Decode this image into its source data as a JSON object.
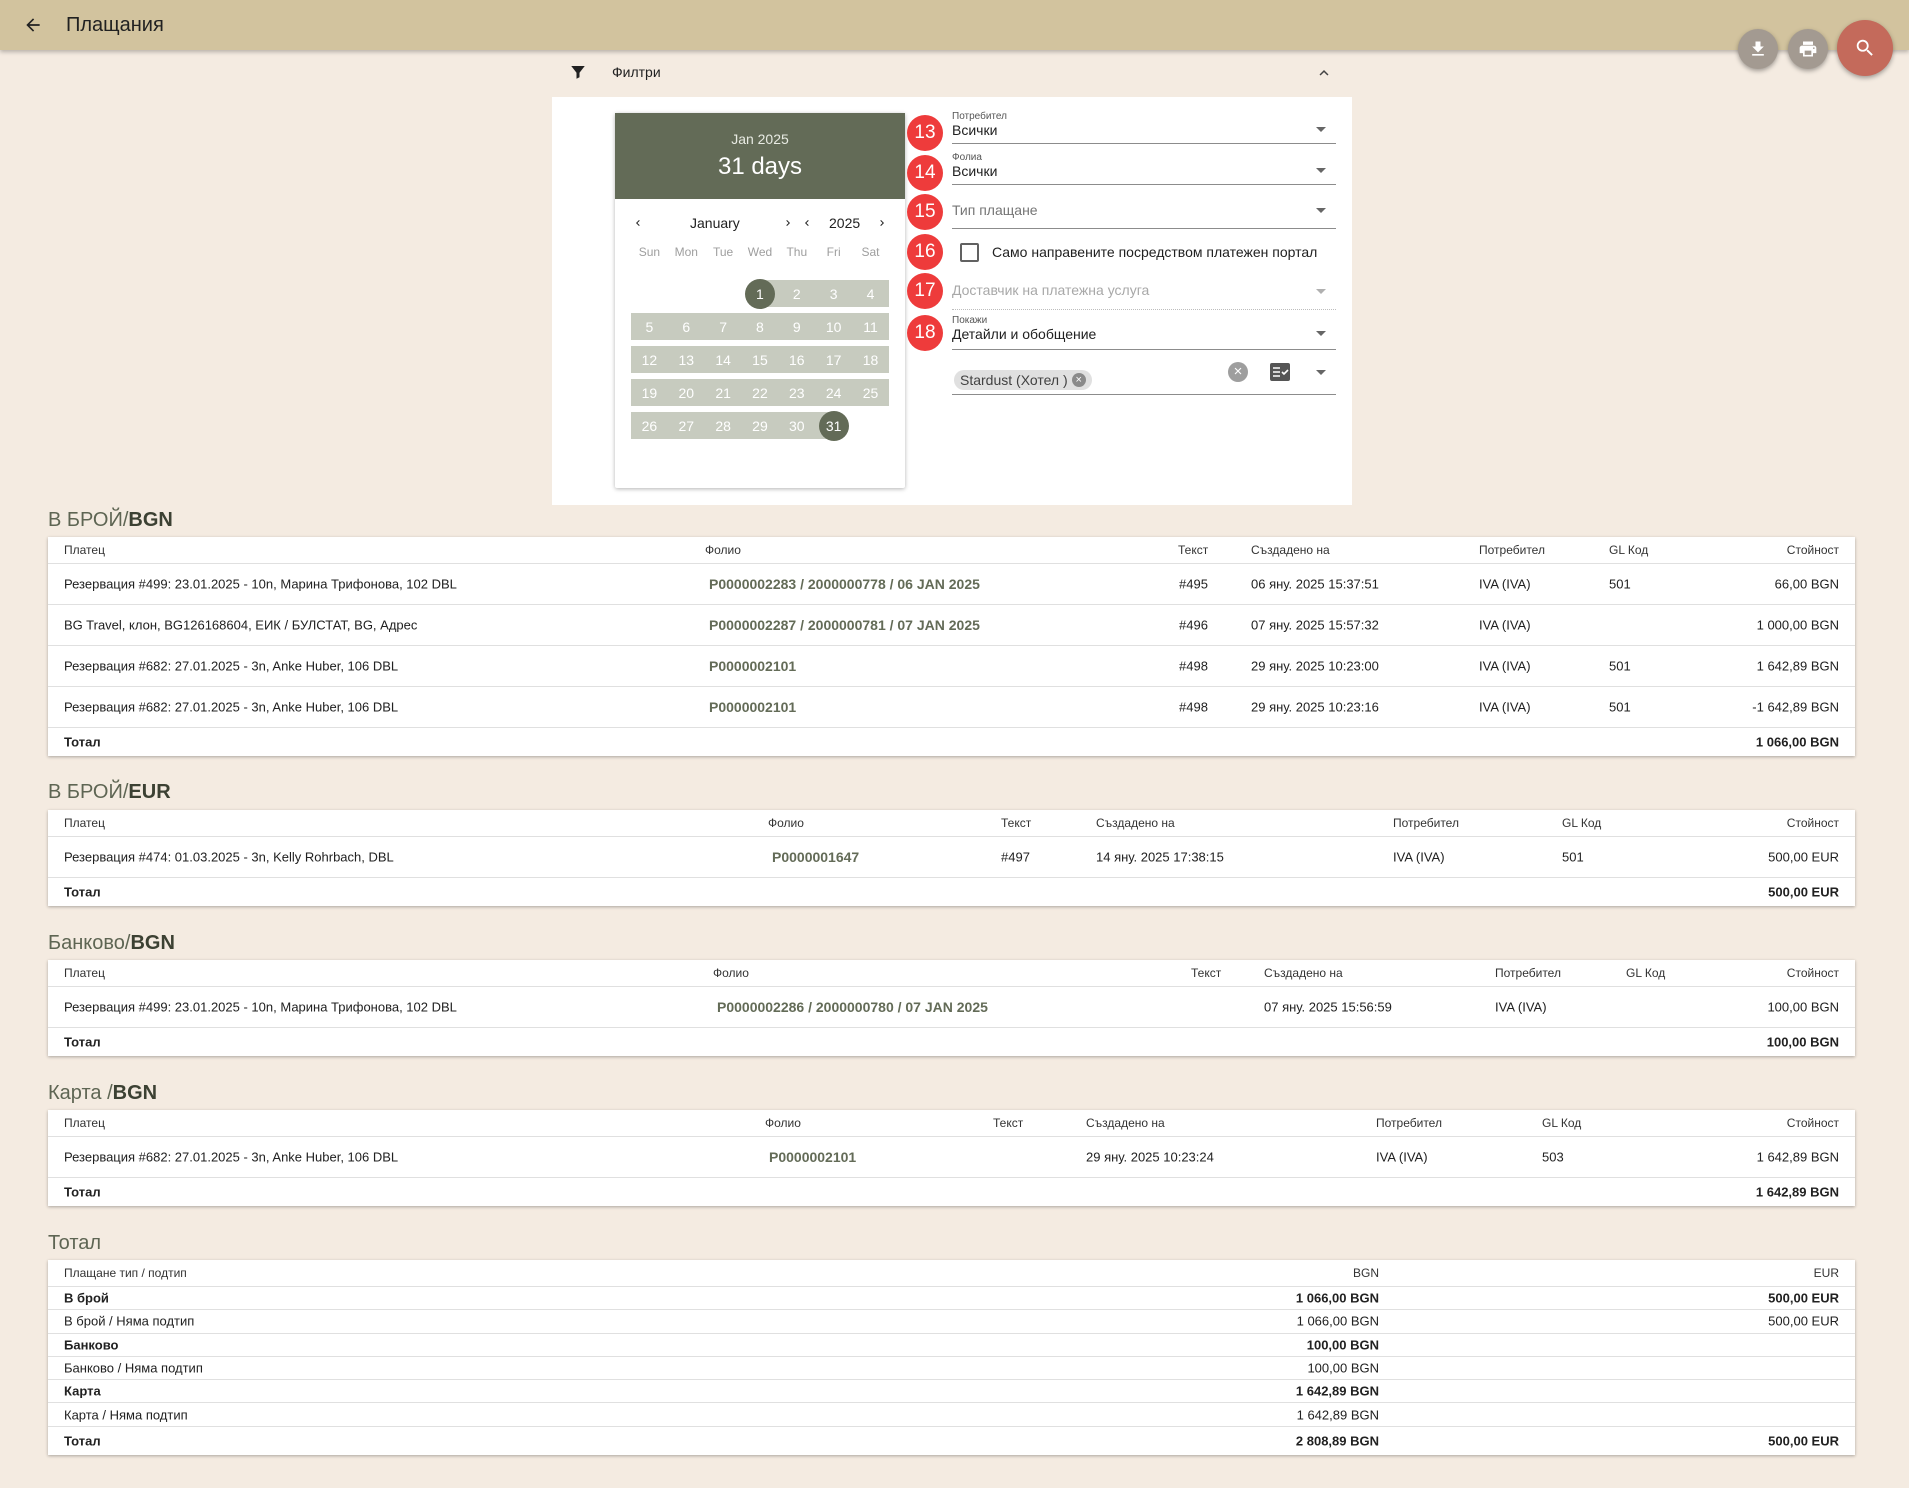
{
  "app": {
    "title": "Плащания"
  },
  "filters": {
    "label": "Филтри",
    "calendar": {
      "header_month": "Jan 2025",
      "header_days": "31 days",
      "month": "January",
      "year": "2025",
      "weekdays": [
        "Sun",
        "Mon",
        "Tue",
        "Wed",
        "Thu",
        "Fri",
        "Sat"
      ],
      "range_start": 1,
      "range_end": 31,
      "leading_blanks": 3,
      "days_in_month": 31
    },
    "fields": {
      "user": {
        "badge": "13",
        "label": "Потребител",
        "value": "Всички"
      },
      "folio": {
        "badge": "14",
        "label": "Фолиа",
        "value": "Всички"
      },
      "payment_type": {
        "badge": "15",
        "placeholder": "Тип плащане"
      },
      "portal_only": {
        "badge": "16",
        "label": "Само направените посредством платежен портал",
        "checked": false
      },
      "provider": {
        "badge": "17",
        "placeholder": "Доставчик на платежна услуга"
      },
      "show": {
        "badge": "18",
        "label": "Покажи",
        "value": "Детайли и обобщение"
      },
      "property_chip": "Stardust (Хотел )"
    }
  },
  "sections": [
    {
      "title_prefix": "В БРОЙ/",
      "title_currency": "BGN",
      "headers": {
        "payer": "Платец",
        "folio": "Фолио",
        "text": "Текст",
        "created": "Създадено на",
        "user": "Потребител",
        "gl": "GL Код",
        "amount": "Стойност"
      },
      "rows": [
        {
          "payer": "Резервация #499: 23.01.2025 - 10n, Марина Трифонова, 102 DBL",
          "folio": "P0000002283 / 2000000778 / 06 JAN 2025",
          "text": "#495",
          "created": "06 яну. 2025 15:37:51",
          "user": "IVA (IVA)",
          "gl": "501",
          "amount": "66,00 BGN"
        },
        {
          "payer": "BG Travel, клон, BG126168604, ЕИК / БУЛСТАТ, BG, Адрес",
          "folio": "P0000002287 / 2000000781 / 07 JAN 2025",
          "text": "#496",
          "created": "07 яну. 2025 15:57:32",
          "user": "IVA (IVA)",
          "gl": "",
          "amount": "1 000,00 BGN"
        },
        {
          "payer": "Резервация #682: 27.01.2025 - 3n, Anke Huber, 106 DBL",
          "folio": "P0000002101",
          "text": "#498",
          "created": "29 яну. 2025 10:23:00",
          "user": "IVA (IVA)",
          "gl": "501",
          "amount": "1 642,89 BGN"
        },
        {
          "payer": "Резервация #682: 27.01.2025 - 3n, Anke Huber, 106 DBL",
          "folio": "P0000002101",
          "text": "#498",
          "created": "29 яну. 2025 10:23:16",
          "user": "IVA (IVA)",
          "gl": "501",
          "amount": "-1 642,89 BGN"
        }
      ],
      "total_label": "Тотал",
      "total": "1 066,00 BGN"
    },
    {
      "title_prefix": "В БРОЙ/",
      "title_currency": "EUR",
      "headers": {
        "payer": "Платец",
        "folio": "Фолио",
        "text": "Текст",
        "created": "Създадено на",
        "user": "Потребител",
        "gl": "GL Код",
        "amount": "Стойност"
      },
      "rows": [
        {
          "payer": "Резервация #474: 01.03.2025 - 3n, Kelly Rohrbach, DBL",
          "folio": "P0000001647",
          "text": "#497",
          "created": "14 яну. 2025 17:38:15",
          "user": "IVA (IVA)",
          "gl": "501",
          "amount": "500,00 EUR"
        }
      ],
      "total_label": "Тотал",
      "total": "500,00 EUR"
    },
    {
      "title_prefix": "Банково/",
      "title_currency": "BGN",
      "headers": {
        "payer": "Платец",
        "folio": "Фолио",
        "text": "Текст",
        "created": "Създадено на",
        "user": "Потребител",
        "gl": "GL Код",
        "amount": "Стойност"
      },
      "rows": [
        {
          "payer": "Резервация #499: 23.01.2025 - 10n, Марина Трифонова, 102 DBL",
          "folio": "P0000002286 / 2000000780 / 07 JAN 2025",
          "text": "",
          "created": "07 яну. 2025 15:56:59",
          "user": "IVA (IVA)",
          "gl": "",
          "amount": "100,00 BGN"
        }
      ],
      "total_label": "Тотал",
      "total": "100,00 BGN"
    },
    {
      "title_prefix": "Карта /",
      "title_currency": "BGN",
      "headers": {
        "payer": "Платец",
        "folio": "Фолио",
        "text": "Текст",
        "created": "Създадено на",
        "user": "Потребител",
        "gl": "GL Код",
        "amount": "Стойност"
      },
      "rows": [
        {
          "payer": "Резервация #682: 27.01.2025 - 3n, Anke Huber, 106 DBL",
          "folio": "P0000002101",
          "text": "",
          "created": "29 яну. 2025 10:23:24",
          "user": "IVA (IVA)",
          "gl": "503",
          "amount": "1 642,89 BGN"
        }
      ],
      "total_label": "Тотал",
      "total": "1 642,89 BGN"
    }
  ],
  "summary": {
    "title": "Тотал",
    "headers": {
      "type": "Плащане тип / подтип",
      "bgn": "BGN",
      "eur": "EUR"
    },
    "rows": [
      {
        "type": "В брой",
        "bgn": "1 066,00 BGN",
        "eur": "500,00 EUR",
        "bold": true
      },
      {
        "type": "В брой / Няма подтип",
        "bgn": "1 066,00 BGN",
        "eur": "500,00 EUR",
        "bold": false
      },
      {
        "type": "Банково",
        "bgn": "100,00 BGN",
        "eur": "",
        "bold": true
      },
      {
        "type": "Банково / Няма подтип",
        "bgn": "100,00 BGN",
        "eur": "",
        "bold": false
      },
      {
        "type": "Карта",
        "bgn": "1 642,89 BGN",
        "eur": "",
        "bold": true
      },
      {
        "type": "Карта / Няма подтип",
        "bgn": "1 642,89 BGN",
        "eur": "",
        "bold": false
      },
      {
        "type": "Тотал",
        "bgn": "2 808,89 BGN",
        "eur": "500,00 EUR",
        "bold": true
      }
    ]
  },
  "icons": {
    "back": "arrow-left-icon",
    "download": "download-icon",
    "print": "print-icon",
    "search": "search-icon",
    "filter": "filter-icon",
    "collapse": "chevron-up-icon"
  },
  "colors": {
    "topbar": "#d2c39e",
    "accent": "#636b57",
    "badge": "#ee3b3b",
    "search_fab": "#c46a5b"
  }
}
